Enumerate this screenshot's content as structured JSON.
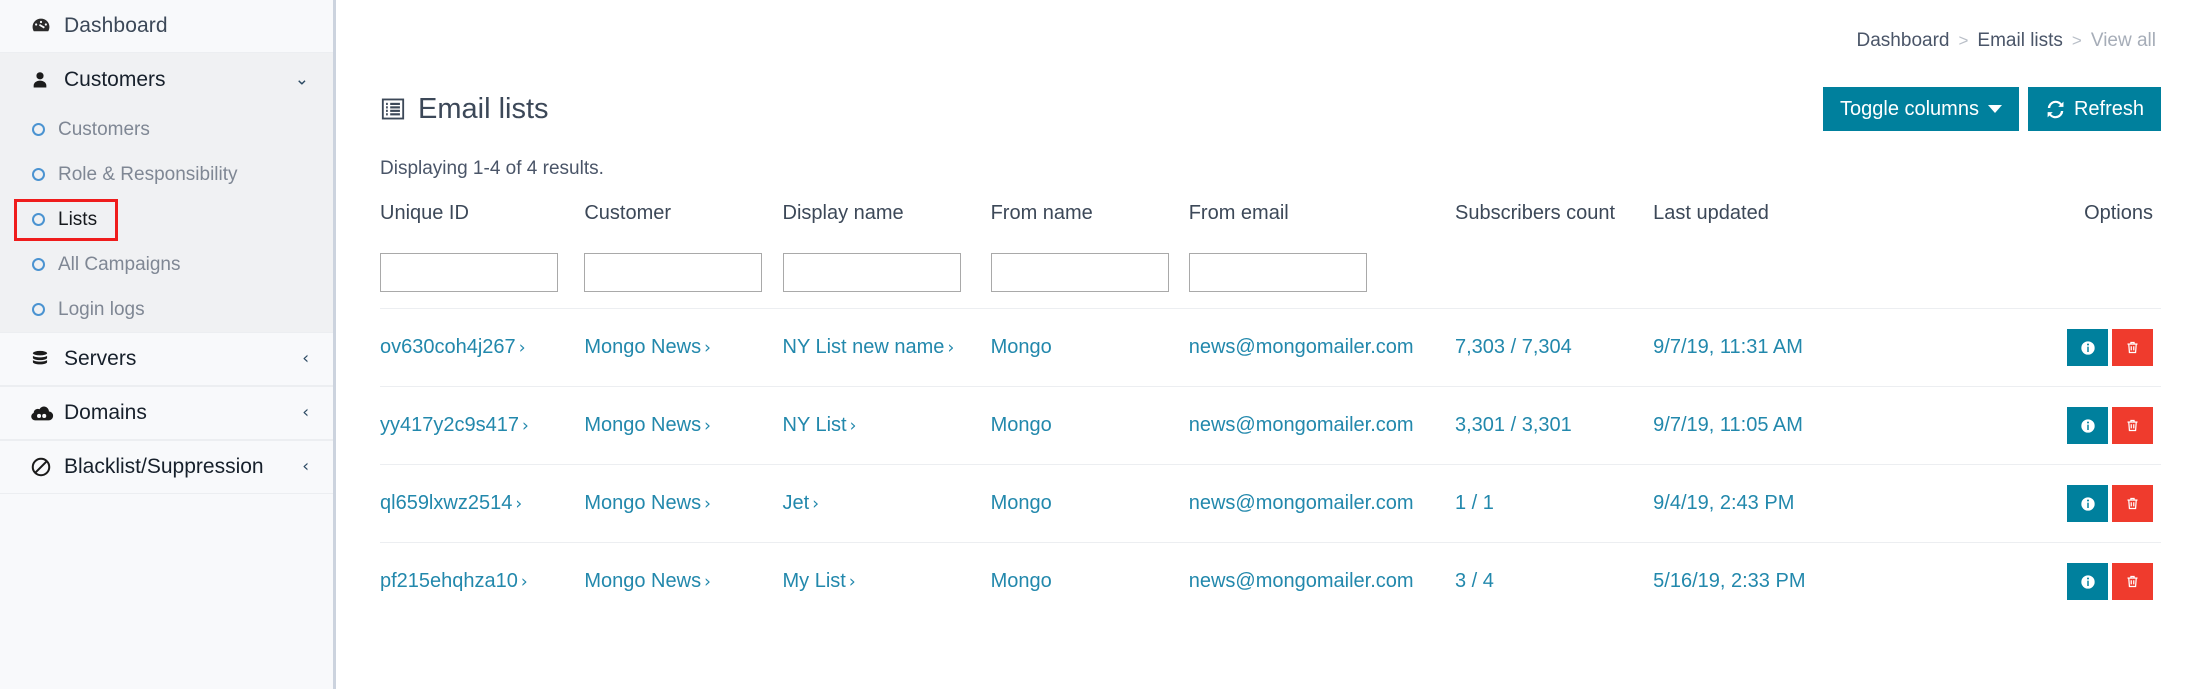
{
  "sidebar": {
    "items": [
      {
        "label": "Dashboard",
        "icon": "dashboard-icon",
        "type": "top",
        "expandable": false
      },
      {
        "label": "Customers",
        "icon": "user-icon",
        "type": "parent",
        "expandable": true,
        "expanded": true,
        "chevron": "chevron-down-icon"
      },
      {
        "label": "Customers",
        "icon": "circle-icon",
        "type": "sub",
        "active": false
      },
      {
        "label": "Role & Responsibility",
        "icon": "circle-icon",
        "type": "sub",
        "active": false
      },
      {
        "label": "Lists",
        "icon": "circle-icon",
        "type": "sub",
        "active": true,
        "highlighted": true
      },
      {
        "label": "All Campaigns",
        "icon": "circle-icon",
        "type": "sub",
        "active": false
      },
      {
        "label": "Login logs",
        "icon": "circle-icon",
        "type": "sub",
        "active": false
      },
      {
        "label": "Servers",
        "icon": "database-icon",
        "type": "parent",
        "expandable": true,
        "expanded": false,
        "chevron": "chevron-left-icon"
      },
      {
        "label": "Domains",
        "icon": "cloud-icon",
        "type": "parent",
        "expandable": true,
        "expanded": false,
        "chevron": "chevron-left-icon"
      },
      {
        "label": "Blacklist/Suppression",
        "icon": "ban-icon",
        "type": "parent",
        "expandable": true,
        "expanded": false,
        "chevron": "chevron-left-icon"
      }
    ]
  },
  "breadcrumb": {
    "items": [
      {
        "label": "Dashboard",
        "current": false
      },
      {
        "label": "Email lists",
        "current": false
      },
      {
        "label": "View all",
        "current": true
      }
    ],
    "separator": ">"
  },
  "header": {
    "title": "Email lists",
    "title_icon": "list-table-icon",
    "toggle_columns_label": "Toggle columns",
    "refresh_label": "Refresh",
    "refresh_icon": "refresh-icon",
    "accent_color": "#00809d"
  },
  "results_text": "Displaying 1-4 of 4 results.",
  "table": {
    "columns": [
      "Unique ID",
      "Customer",
      "Display name",
      "From name",
      "From email",
      "Subscribers count",
      "Last updated",
      "Options"
    ],
    "filters": [
      {
        "name": "unique-id-filter",
        "value": "",
        "placeholder": ""
      },
      {
        "name": "customer-filter",
        "value": "",
        "placeholder": ""
      },
      {
        "name": "display-name-filter",
        "value": "",
        "placeholder": ""
      },
      {
        "name": "from-name-filter",
        "value": "",
        "placeholder": ""
      },
      {
        "name": "from-email-filter",
        "value": "",
        "placeholder": ""
      }
    ],
    "rows": [
      {
        "unique_id": "ov630coh4j267",
        "customer": "Mongo News",
        "display_name": "NY List new name",
        "from_name": "Mongo",
        "from_email": "news@mongomailer.com",
        "subscribers_count": "7,303 / 7,304",
        "last_updated": "9/7/19, 11:31 AM",
        "info_icon": "info-icon",
        "delete_icon": "trash-icon"
      },
      {
        "unique_id": "yy417y2c9s417",
        "customer": "Mongo News",
        "display_name": "NY List",
        "from_name": "Mongo",
        "from_email": "news@mongomailer.com",
        "subscribers_count": "3,301 / 3,301",
        "last_updated": "9/7/19, 11:05 AM",
        "info_icon": "info-icon",
        "delete_icon": "trash-icon"
      },
      {
        "unique_id": "ql659lxwz2514",
        "customer": "Mongo News",
        "display_name": "Jet",
        "from_name": "Mongo",
        "from_email": "news@mongomailer.com",
        "subscribers_count": "1 / 1",
        "last_updated": "9/4/19, 2:43 PM",
        "info_icon": "info-icon",
        "delete_icon": "trash-icon"
      },
      {
        "unique_id": "pf215ehqhza10",
        "customer": "Mongo News",
        "display_name": "My List",
        "from_name": "Mongo",
        "from_email": "news@mongomailer.com",
        "subscribers_count": "3 / 4",
        "last_updated": "5/16/19, 2:33 PM",
        "info_icon": "info-icon",
        "delete_icon": "trash-icon"
      }
    ],
    "link_arrow": "›",
    "link_color": "#2288ac",
    "info_button_color": "#00809d",
    "delete_button_color": "#ef3b2d"
  },
  "annotation": {
    "highlight_color": "#ef1c1c",
    "highlight_target": "Lists"
  }
}
